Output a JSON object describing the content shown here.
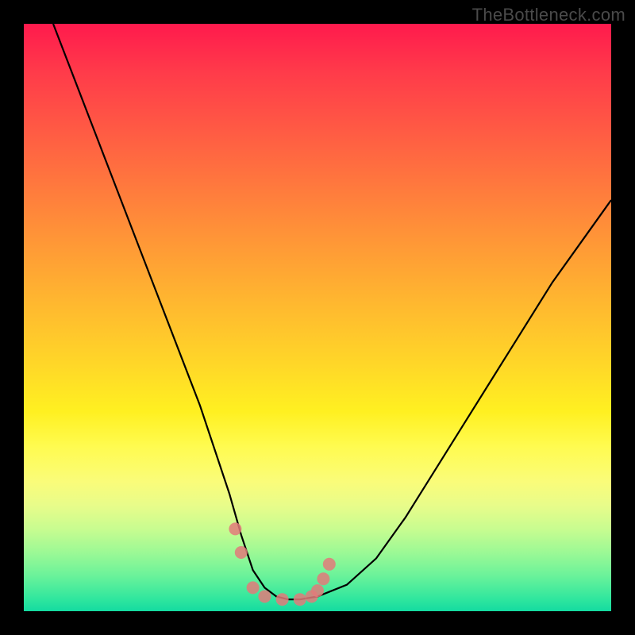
{
  "watermark": "TheBottleneck.com",
  "colors": {
    "page_bg": "#000000",
    "curve_stroke": "#000000",
    "dot_stroke": "#e27a7a",
    "dot_fill": "#e27a7a",
    "gradient_top": "#ff1a4d",
    "gradient_mid": "#fff021",
    "gradient_bottom": "#14dba0"
  },
  "chart_data": {
    "type": "line",
    "title": "",
    "xlabel": "",
    "ylabel": "",
    "xlim": [
      0,
      100
    ],
    "ylim": [
      0,
      100
    ],
    "grid": false,
    "series": [
      {
        "name": "bottleneck-curve",
        "x": [
          5,
          10,
          15,
          20,
          25,
          30,
          35,
          37,
          39,
          41,
          43,
          45,
          47,
          50,
          55,
          60,
          65,
          70,
          75,
          80,
          85,
          90,
          95,
          100
        ],
        "y": [
          100,
          87,
          74,
          61,
          48,
          35,
          20,
          13,
          7,
          4,
          2.5,
          2,
          2,
          2.5,
          4.5,
          9,
          16,
          24,
          32,
          40,
          48,
          56,
          63,
          70
        ]
      }
    ],
    "highlight_points": {
      "name": "pink-dots",
      "x": [
        36,
        37,
        39,
        41,
        44,
        47,
        49,
        50,
        51,
        52
      ],
      "y": [
        14,
        10,
        4,
        2.5,
        2,
        2,
        2.5,
        3.5,
        5.5,
        8
      ]
    }
  }
}
